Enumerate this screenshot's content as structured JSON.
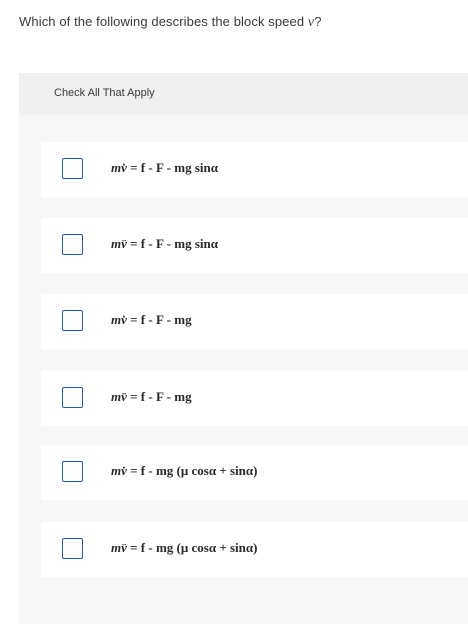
{
  "question": {
    "text_before": "Which of the following describes the block speed ",
    "variable": "v",
    "text_after": "?"
  },
  "panel": {
    "instruction": "Check All That Apply"
  },
  "options": [
    {
      "formula_lhs": "mv̇",
      "formula_rhs": "= f - F - mg sinα"
    },
    {
      "formula_lhs": "mv̈",
      "formula_rhs": "= f - F - mg sinα"
    },
    {
      "formula_lhs": "mv̇",
      "formula_rhs": "= f - F - mg"
    },
    {
      "formula_lhs": "mv̈",
      "formula_rhs": "= f - F - mg"
    },
    {
      "formula_lhs": "mv̇",
      "formula_rhs": "= f - mg (μ cosα + sinα)"
    },
    {
      "formula_lhs": "mv̈",
      "formula_rhs": "= f - mg (μ cosα + sinα)"
    }
  ]
}
